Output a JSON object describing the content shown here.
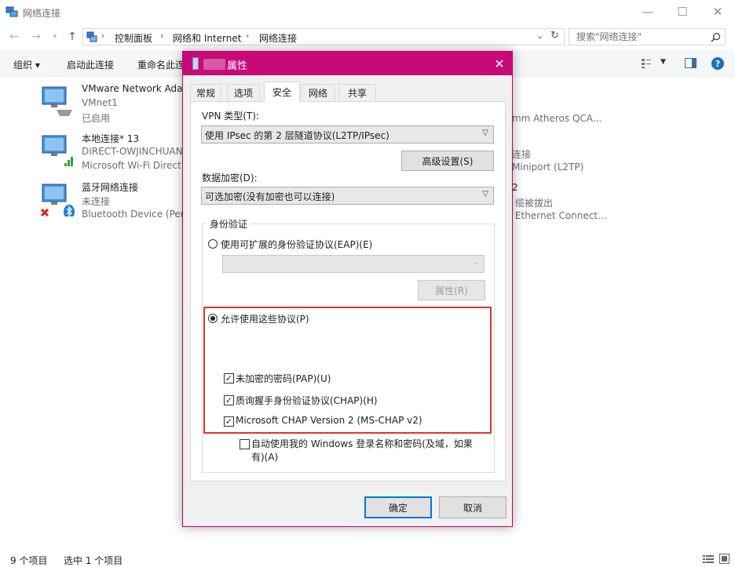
{
  "window": {
    "title": "网络连接",
    "address": {
      "crumbs": [
        "控制面板",
        "网络和 Internet",
        "网络连接"
      ]
    },
    "search_placeholder": "搜索\"网络连接\""
  },
  "toolbar": {
    "organize": "组织 ▾",
    "enable_device": "启动此连接",
    "rename": "重命名此连"
  },
  "connections": [
    {
      "name": "VMware Network Ada",
      "status": "VMnet1",
      "device": "已启用",
      "icon": "network-adapter-icon"
    },
    {
      "name": "本地连接* 13",
      "status": "DIRECT-OWJINCHUAN",
      "device": "Microsoft Wi-Fi Direct",
      "icon": "wifi-adapter-icon"
    },
    {
      "name": "蓝牙网络连接",
      "status": "未连接",
      "device": "Bluetooth Device (Pers",
      "icon": "bluetooth-adapter-icon"
    }
  ],
  "right_column": [
    "mm Atheros QCA...",
    "连接",
    "Miniport (L2TP)",
    "2",
    "缆被拔出",
    "Ethernet Connect..."
  ],
  "statusbar": {
    "items": "9 个项目",
    "selected": "选中 1 个项目"
  },
  "dialog": {
    "title": "属性",
    "tabs": [
      "常规",
      "选项",
      "安全",
      "网络",
      "共享"
    ],
    "active_tab": "安全",
    "vpn_type_label": "VPN 类型(T):",
    "vpn_type_value": "使用 IPsec 的第 2 层隧道协议(L2TP/IPsec)",
    "advanced_button": "高级设置(S)",
    "encryption_label": "数据加密(D):",
    "encryption_value": "可选加密(没有加密也可以连接)",
    "auth_group": "身份验证",
    "eap_radio": "使用可扩展的身份验证协议(EAP)(E)",
    "eap_combo_value": "",
    "properties_button": "属性(R)",
    "allow_radio": "允许使用这些协议(P)",
    "protocols": [
      {
        "label": "未加密的密码(PAP)(U)",
        "checked": true
      },
      {
        "label": "质询握手身份验证协议(CHAP)(H)",
        "checked": true
      },
      {
        "label": "Microsoft CHAP Version 2 (MS-CHAP v2)",
        "checked": true
      }
    ],
    "auto_windows_line1": "自动使用我的 Windows 登录名称和密码(及域，如果",
    "auto_windows_line2": "有)(A)",
    "auto_windows_checked": false,
    "ok_button": "确定",
    "cancel_button": "取消"
  },
  "colors": {
    "dialog_titlebar": "#c8097a",
    "highlight_box": "#e3312e",
    "primary_button_border": "#0078d7"
  }
}
